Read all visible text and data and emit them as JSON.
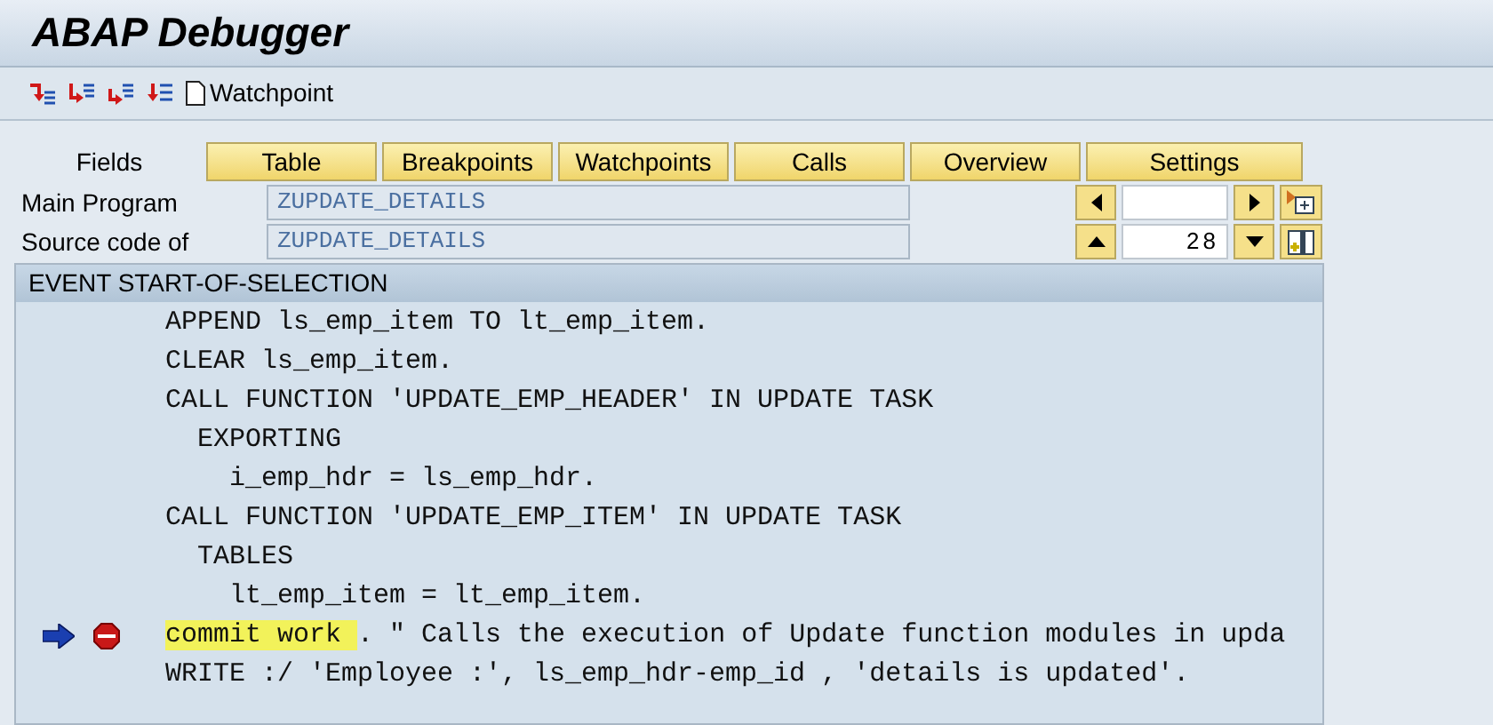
{
  "window": {
    "title": "ABAP Debugger"
  },
  "toolbar": {
    "watchpoint_button": "Watchpoint"
  },
  "tabs": [
    {
      "label": "Fields",
      "selected": true
    },
    {
      "label": "Table",
      "selected": false
    },
    {
      "label": "Breakpoints",
      "selected": false
    },
    {
      "label": "Watchpoints",
      "selected": false
    },
    {
      "label": "Calls",
      "selected": false
    },
    {
      "label": "Overview",
      "selected": false
    },
    {
      "label": "Settings",
      "selected": false
    }
  ],
  "main_program": {
    "label": "Main Program",
    "value": "ZUPDATE_DETAILS"
  },
  "source_code_of": {
    "label": "Source code of",
    "value": "ZUPDATE_DETAILS",
    "line": "28"
  },
  "event_header": "EVENT START-OF-SELECTION",
  "code_lines": [
    {
      "segments": [
        {
          "text": "APPEND ls_emp_item TO lt_emp_item.",
          "highlighted": false
        }
      ],
      "current": false,
      "breakpoint": false
    },
    {
      "segments": [
        {
          "text": "CLEAR ls_emp_item.",
          "highlighted": false
        }
      ],
      "current": false,
      "breakpoint": false
    },
    {
      "segments": [
        {
          "text": "CALL FUNCTION 'UPDATE_EMP_HEADER' IN UPDATE TASK",
          "highlighted": false
        }
      ],
      "current": false,
      "breakpoint": false
    },
    {
      "segments": [
        {
          "text": "  EXPORTING",
          "highlighted": false
        }
      ],
      "current": false,
      "breakpoint": false
    },
    {
      "segments": [
        {
          "text": "    i_emp_hdr = ls_emp_hdr.",
          "highlighted": false
        }
      ],
      "current": false,
      "breakpoint": false
    },
    {
      "segments": [
        {
          "text": "CALL FUNCTION 'UPDATE_EMP_ITEM' IN UPDATE TASK",
          "highlighted": false
        }
      ],
      "current": false,
      "breakpoint": false
    },
    {
      "segments": [
        {
          "text": "  TABLES",
          "highlighted": false
        }
      ],
      "current": false,
      "breakpoint": false
    },
    {
      "segments": [
        {
          "text": "    lt_emp_item = lt_emp_item.",
          "highlighted": false
        }
      ],
      "current": false,
      "breakpoint": false
    },
    {
      "segments": [
        {
          "text": "commit work ",
          "highlighted": true
        },
        {
          "text": ". \" Calls the execution of Update function modules in upda",
          "highlighted": false
        }
      ],
      "current": true,
      "breakpoint": true
    },
    {
      "segments": [
        {
          "text": "WRITE :/ 'Employee :', ls_emp_hdr-emp_id , 'details is updated'.",
          "highlighted": false
        }
      ],
      "current": false,
      "breakpoint": false
    }
  ]
}
